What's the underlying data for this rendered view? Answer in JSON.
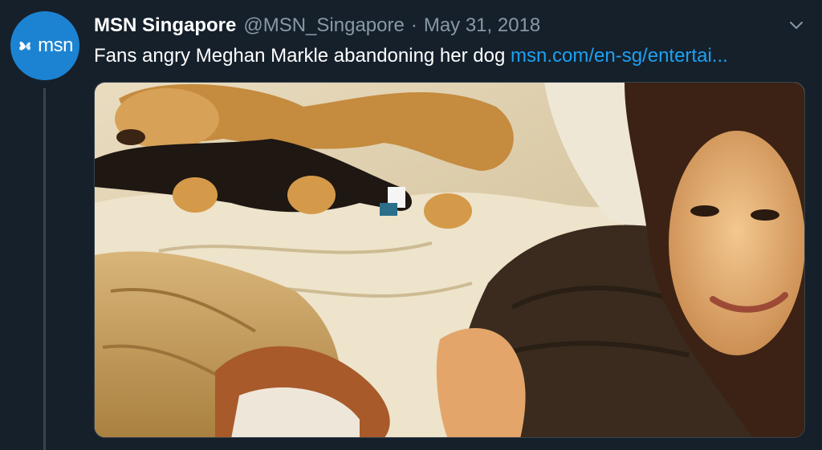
{
  "tweet": {
    "author": {
      "display_name": "MSN Singapore",
      "handle": "@MSN_Singapore",
      "avatar_text": "msn"
    },
    "separator": "·",
    "date": "May 31, 2018",
    "text": "Fans angry Meghan Markle abandoning her dog ",
    "link": "msn.com/en-sg/entertai..."
  },
  "icons": {
    "avatar_logo": "butterfly-icon",
    "menu": "chevron-down-icon"
  },
  "colors": {
    "background": "#15202b",
    "avatar": "#1c83d3",
    "link": "#1da1f2",
    "secondary_text": "#8899a6",
    "thread_line": "#38444d"
  }
}
